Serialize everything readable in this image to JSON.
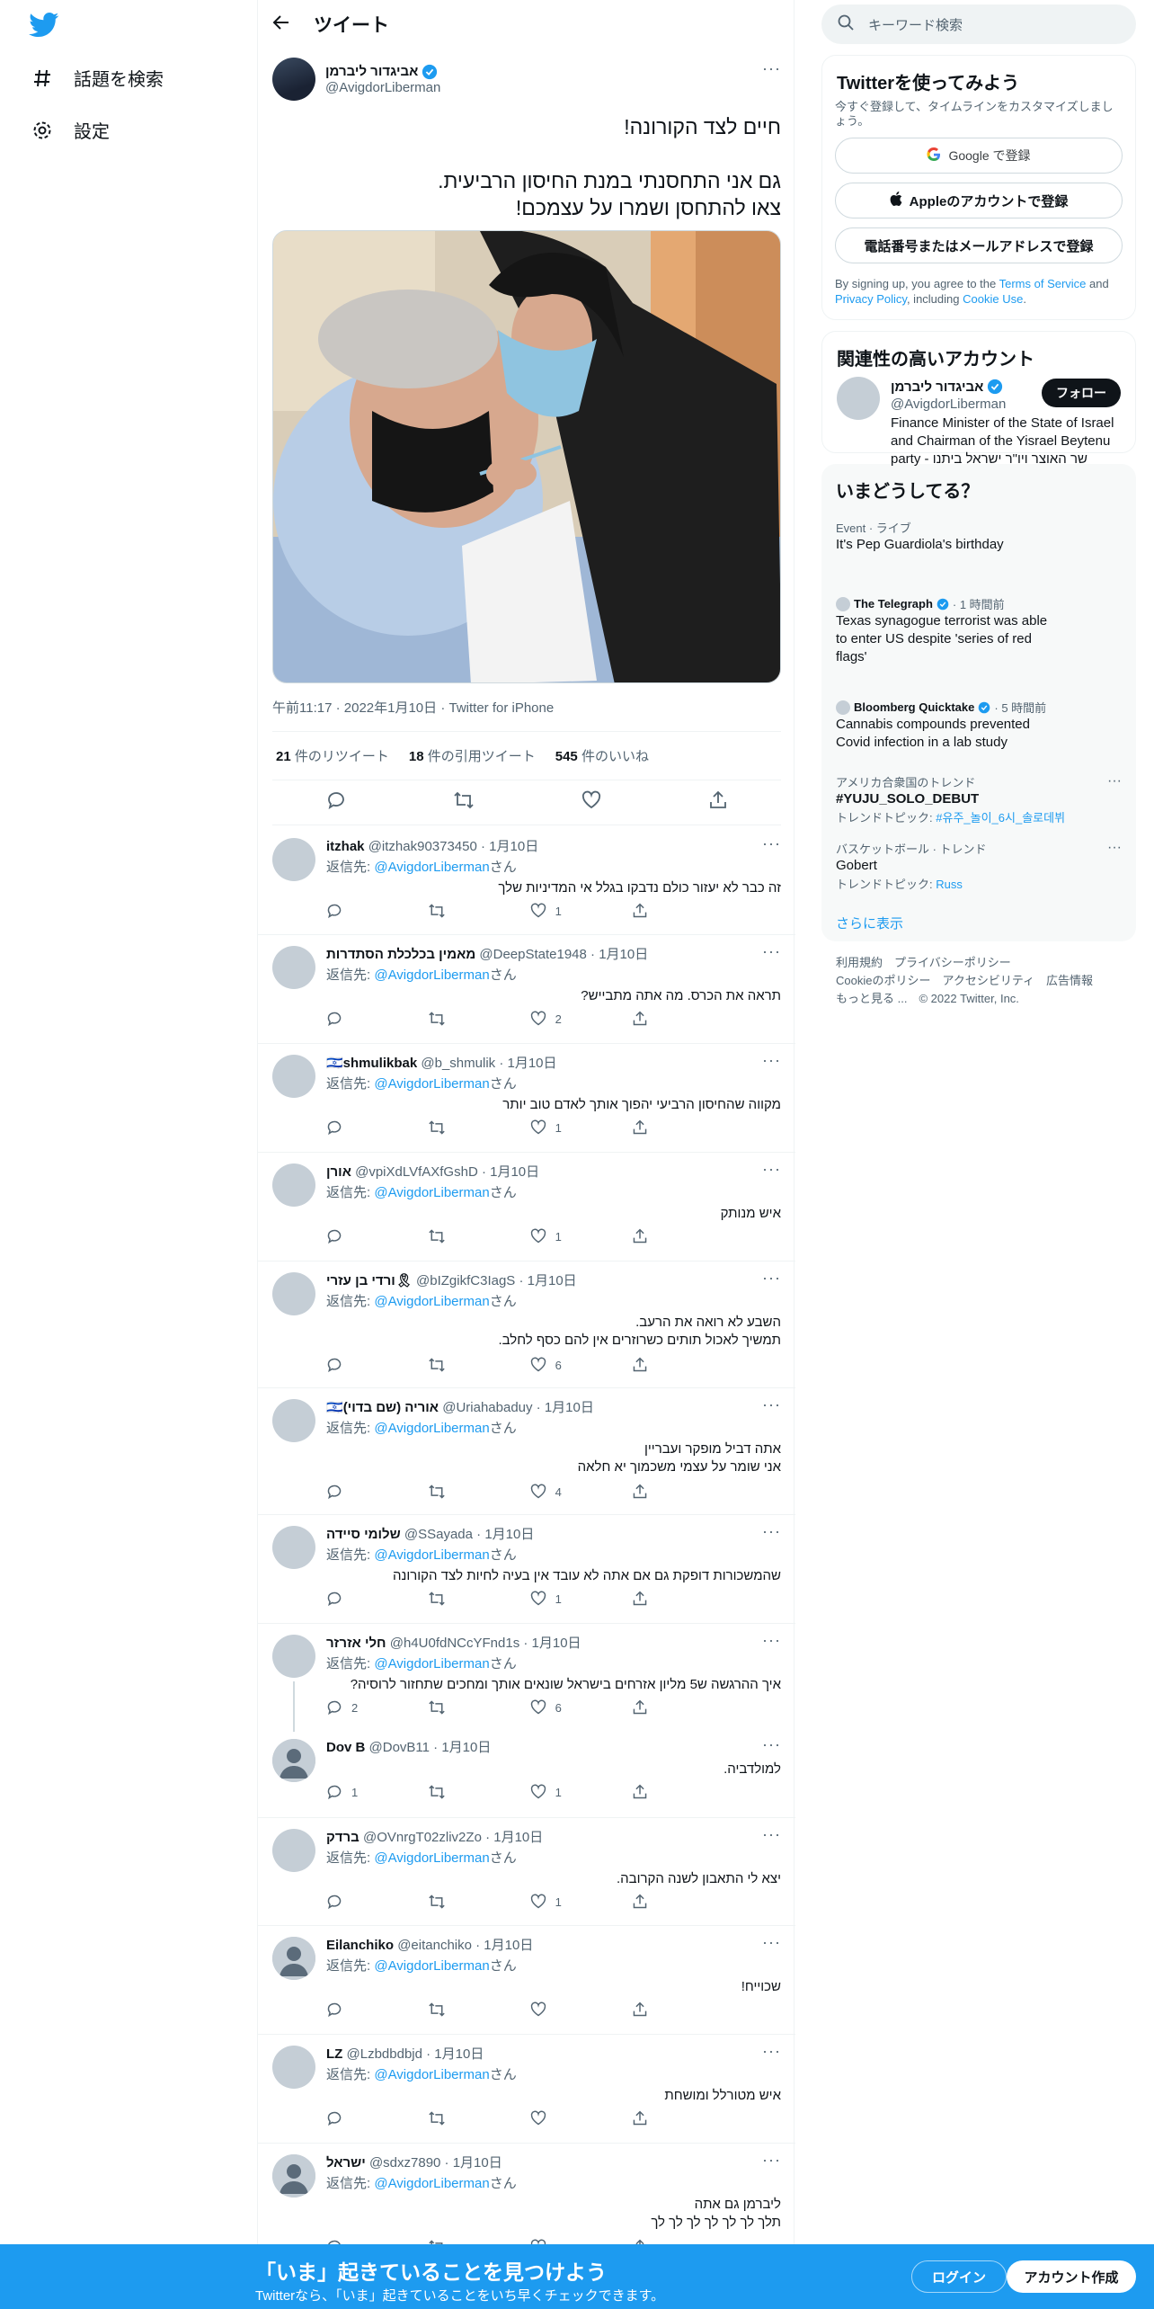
{
  "nav": {
    "explore_label": "話題を検索",
    "settings_label": "設定"
  },
  "header": {
    "title": "ツイート"
  },
  "tweet": {
    "author_name": "אביגדור ליברמן",
    "author_handle": "@AvigdorLiberman",
    "text": "חיים לצד הקורונה!\n\nגם אני התחסנתי במנת החיסון הרביעית.\nצאו להתחסן ושמרו על עצמכם!",
    "meta": "午前11:17 · 2022年1月10日 · Twitter for iPhone",
    "retweets": "21",
    "retweets_label": "件のリツイート",
    "quotes": "18",
    "quotes_label": "件の引用ツイート",
    "likes": "545",
    "likes_label": "件のいいね"
  },
  "replies": [
    {
      "name": "itzhak",
      "handle": "@itzhak90373450 · 1月10日",
      "to": "@AvigdorLiberman",
      "text": "זה כבר לא יעזור כולם נדבקו בגלל אי המדיניות שלך",
      "replies": "",
      "likes": "1"
    },
    {
      "name": "מאמין בכלכלת הסתדרות",
      "handle": "@DeepState1948 · 1月10日",
      "to": "@AvigdorLiberman",
      "text": "תראה את הכרס. מה אתה מתבייש?",
      "replies": "",
      "likes": "2"
    },
    {
      "name": "🇮🇱shmulikbak",
      "handle": "@b_shmulik · 1月10日",
      "to": "@AvigdorLiberman",
      "text": "מקווה שהחיסון הרביעי יהפוך אותך לאדם טוב יותר",
      "replies": "",
      "likes": "1"
    },
    {
      "name": "אורן",
      "handle": "@vpiXdLVfAXfGshD · 1月10日",
      "to": "@AvigdorLiberman",
      "text": "איש מנותק",
      "replies": "",
      "likes": "1"
    },
    {
      "name": "ורדי בן עזרי🎗",
      "handle": "@bIZgikfC3IagS · 1月10日",
      "to": "@AvigdorLiberman",
      "text": "השבע לא רואה את הרעב.\nתמשיך לאכול תותים כשרוזרים אין להם כסף לחלב.",
      "replies": "",
      "likes": "6"
    },
    {
      "name": "🇮🇱אוריה (שם בדוי)",
      "handle": "@Uriahabaduy · 1月10日",
      "to": "@AvigdorLiberman",
      "text": "אתה דביל מופקר ועבריין\nאני שומר על עצמי משכמוך יא חלאה",
      "replies": "",
      "likes": "4"
    },
    {
      "name": "שלומי סיידה",
      "handle": "@SSayada · 1月10日",
      "to": "@AvigdorLiberman",
      "text": "שהמשכורות דופקת גם אם אתה לא עובד אין בעיה לחיות לצד הקורונה",
      "replies": "",
      "likes": "1"
    },
    {
      "name": "חלי אזרזר",
      "handle": "@h4U0fdNCcYFnd1s · 1月10日",
      "to": "@AvigdorLiberman",
      "text": "איך ההרגשה ש5 מליון אזרחים בישראל שונאים אותך ומחכים שתחזור לרוסיה?",
      "replies": "2",
      "likes": "6"
    },
    {
      "name": "Dov B",
      "handle": "@DovB11 · 1月10日",
      "to": "",
      "text": "למולדביה.",
      "replies": "1",
      "likes": "1"
    },
    {
      "name": "ברדק",
      "handle": "@OVnrgT02zliv2Zo · 1月10日",
      "to": "@AvigdorLiberman",
      "text": "יצא לי התאבון לשנה הקרובה.",
      "replies": "",
      "likes": "1"
    },
    {
      "name": "Eilanchiko",
      "handle": "@eitanchiko · 1月10日",
      "to": "@AvigdorLiberman",
      "text": "שכוייח!",
      "replies": "",
      "likes": ""
    },
    {
      "name": "LZ",
      "handle": "@Lzbdbdbjd · 1月10日",
      "to": "@AvigdorLiberman",
      "text": "איש מטורלל ומושחת",
      "replies": "",
      "likes": ""
    },
    {
      "name": "ישראל",
      "handle": "@sdxz7890 · 1月10日",
      "to": "@AvigdorLiberman",
      "text": "ליברמן גם אתה\nתלך לך לך לך לך לך לך",
      "replies": "",
      "likes": ""
    }
  ],
  "reply_to_label": "返信先:",
  "reply_to_suffix": "さん",
  "search": {
    "placeholder": "キーワード検索"
  },
  "signup": {
    "title": "Twitterを使ってみよう",
    "desc": "今すぐ登録して、タイムラインをカスタマイズしましょう。",
    "google": "Google で登録",
    "apple": "Appleのアカウントで登録",
    "phone": "電話番号またはメールアドレスで登録",
    "legal_1": "By signing up, you agree to the ",
    "terms": "Terms of Service",
    "legal_2": " and ",
    "privacy": "Privacy Policy",
    "legal_3": ", including ",
    "cookie": "Cookie Use",
    "legal_4": "."
  },
  "related": {
    "title": "関連性の高いアカウント",
    "name": "אביגדור ליברמן",
    "handle": "@AvigdorLiberman",
    "bio": "Finance Minister of the State of Israel and Chairman of the Yisrael Beytenu party - שר האוצר ויו\"ר ישראל ביתנו",
    "follow": "フォロー"
  },
  "trends": {
    "title": "いまどうしてる？",
    "t1_ctx": "Event · ライブ",
    "t1_title": "It's Pep Guardiola's birthday",
    "t2_src": "The Telegraph",
    "t2_time": "· 1 時間前",
    "t2_title": "Texas synagogue terrorist was able to enter US despite 'series of red flags'",
    "t3_src": "Bloomberg Quicktake",
    "t3_time": "· 5 時間前",
    "t3_title": "Cannabis compounds prevented Covid infection in a lab study",
    "t4_ctx": "アメリカ合衆国のトレンド",
    "t4_title": "#YUJU_SOLO_DEBUT",
    "t4_sub": "トレンドトピック:",
    "t4_link": "#유주_놀이_6시_솔로데뷔",
    "t5_ctx": "バスケットボール · トレンド",
    "t5_title": "Gobert",
    "t5_sub": "トレンドトピック:",
    "t5_link": "Russ",
    "more": "さらに表示"
  },
  "footer": {
    "l1": "利用規約　プライバシーポリシー",
    "l2": "Cookieのポリシー　アクセシビリティ　広告情報",
    "l3": "もっと見る ...　© 2022 Twitter, Inc."
  },
  "bottom": {
    "big": "「いま」起きていることを見つけよう",
    "small": "Twitterなら、「いま」起きていることをいち早くチェックできます。",
    "login": "ログイン",
    "create": "アカウント作成"
  },
  "colors": {
    "accent": "#1d9bf0",
    "text": "#0f1419",
    "muted": "#536471"
  }
}
